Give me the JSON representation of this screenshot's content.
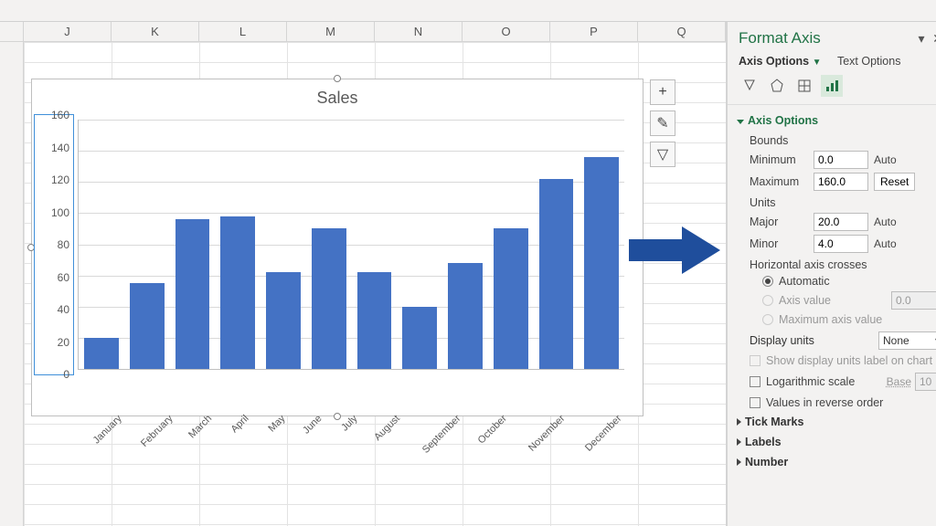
{
  "columns": [
    "J",
    "K",
    "L",
    "M",
    "N",
    "O",
    "P",
    "Q"
  ],
  "chart_data": {
    "type": "bar",
    "title": "Sales",
    "categories": [
      "January",
      "February",
      "March",
      "April",
      "May",
      "June",
      "July",
      "August",
      "September",
      "October",
      "November",
      "December"
    ],
    "values": [
      20,
      55,
      96,
      98,
      62,
      90,
      62,
      40,
      68,
      90,
      122,
      136
    ],
    "xlabel": "",
    "ylabel": "",
    "ylim": [
      0,
      160
    ],
    "y_major_unit": 20,
    "y_minor_unit": 4,
    "y_ticks": [
      0,
      20,
      40,
      60,
      80,
      100,
      120,
      140,
      160
    ]
  },
  "chart_buttons": {
    "add": "+",
    "style": "✎",
    "filter": "▽"
  },
  "pane": {
    "title": "Format Axis",
    "tabs": {
      "main": "Axis Options",
      "text": "Text Options"
    },
    "sections": {
      "axis_options": {
        "label": "Axis Options",
        "bounds_label": "Bounds",
        "min_label": "Minimum",
        "min_value": "0.0",
        "min_auto": "Auto",
        "max_label": "Maximum",
        "max_value": "160.0",
        "max_reset": "Reset",
        "units_label": "Units",
        "major_label": "Major",
        "major_value": "20.0",
        "major_auto": "Auto",
        "minor_label": "Minor",
        "minor_value": "4.0",
        "minor_auto": "Auto",
        "hac_label": "Horizontal axis crosses",
        "hac_auto": "Automatic",
        "hac_axis_value": "Axis value",
        "hac_axis_value_val": "0.0",
        "hac_max": "Maximum axis value",
        "display_units_label": "Display units",
        "display_units_value": "None",
        "show_units_label": "Show display units label on chart",
        "log_label": "Logarithmic scale",
        "base_label": "Base",
        "base_value": "10",
        "reverse_label": "Values in reverse order"
      },
      "tick_marks": "Tick Marks",
      "labels": "Labels",
      "number": "Number"
    }
  }
}
